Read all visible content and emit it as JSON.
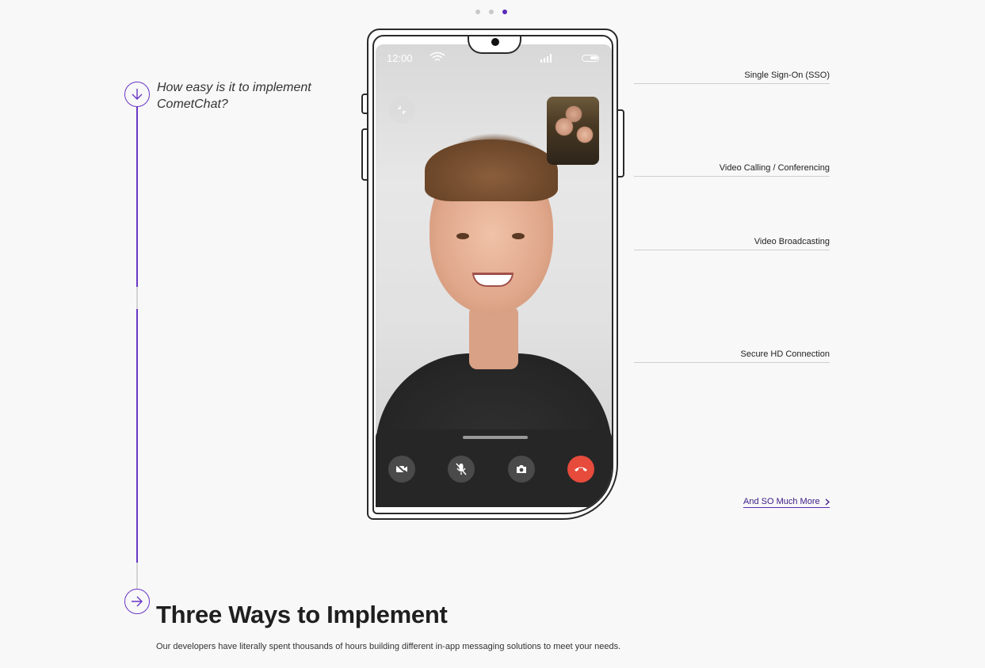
{
  "carousel": {
    "dots": 3,
    "active_index": 2
  },
  "timeline": {
    "question": "How easy is it to implement CometChat?"
  },
  "phone": {
    "status_time": "12:00",
    "controls": [
      "video-off",
      "mic-off",
      "switch-camera",
      "end-call"
    ]
  },
  "features": [
    {
      "label": "Single Sign-On (SSO)"
    },
    {
      "label": "Video Calling / Conferencing"
    },
    {
      "label": "Video Broadcasting"
    },
    {
      "label": "Secure HD Connection"
    }
  ],
  "more_link": {
    "label": "And SO Much More",
    "icon": "chevron-right-icon"
  },
  "section": {
    "title": "Three Ways to Implement",
    "description": "Our developers have literally spent thousands of hours building different in-app messaging solutions to meet your needs."
  },
  "colors": {
    "accent": "#6a36c6",
    "end_call": "#e64b3c",
    "controls_bg": "#262626",
    "page_bg": "#f8f8f8"
  }
}
